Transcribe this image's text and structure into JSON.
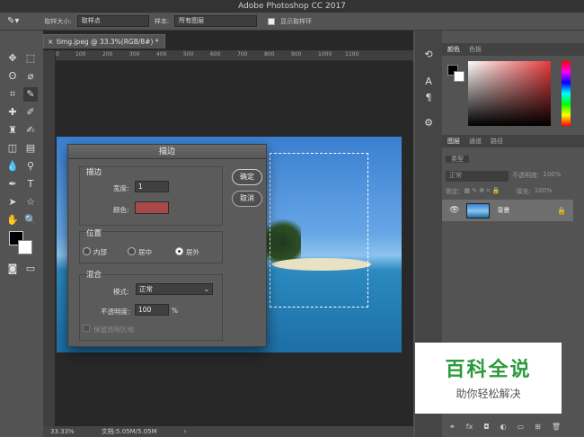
{
  "app": {
    "title": "Adobe Photoshop CC 2017"
  },
  "options_bar": {
    "sample_size_label": "取样大小:",
    "sample_size_value": "取样点",
    "sample_label": "样本:",
    "sample_value": "所有图层",
    "show_ring_label": "显示取样环"
  },
  "document": {
    "tab_title": "timg.jpeg @ 33.3%(RGB/8#) *",
    "ruler_ticks": [
      "0",
      "100",
      "200",
      "300",
      "400",
      "500",
      "600",
      "700",
      "800",
      "900",
      "1000",
      "1100"
    ]
  },
  "status": {
    "zoom": "33.33%",
    "doc_size": "文档:5.05M/5.05M"
  },
  "color_panel": {
    "tabs": [
      "颜色",
      "色板"
    ],
    "colors": {
      "fg": "#000000",
      "bg": "#ffffff",
      "accent": "#e63c3c"
    }
  },
  "layers_panel": {
    "tabs": [
      "图层",
      "通道",
      "路径"
    ],
    "filter_label": "类型",
    "blend_mode": "正常",
    "opacity_label": "不透明度:",
    "opacity_value": "100%",
    "lock_label": "锁定:",
    "fill_label": "填充:",
    "fill_value": "100%",
    "layers": [
      {
        "name": "背景"
      }
    ]
  },
  "stroke_dialog": {
    "title": "描边",
    "stroke_group": "描边",
    "width_label": "宽度:",
    "width_value": "1",
    "color_label": "颜色:",
    "color_value": "#a84848",
    "ok": "确定",
    "cancel": "取消",
    "location_group": "位置",
    "location_options": [
      "内部",
      "居中",
      "居外"
    ],
    "location_selected": "居外",
    "blend_group": "混合",
    "mode_label": "模式:",
    "mode_value": "正常",
    "opacity_label": "不透明度:",
    "opacity_value": "100",
    "opacity_unit": "%",
    "preserve_label": "保留透明区域"
  },
  "watermark": {
    "title": "百科全说",
    "subtitle": "助你轻松解决"
  }
}
